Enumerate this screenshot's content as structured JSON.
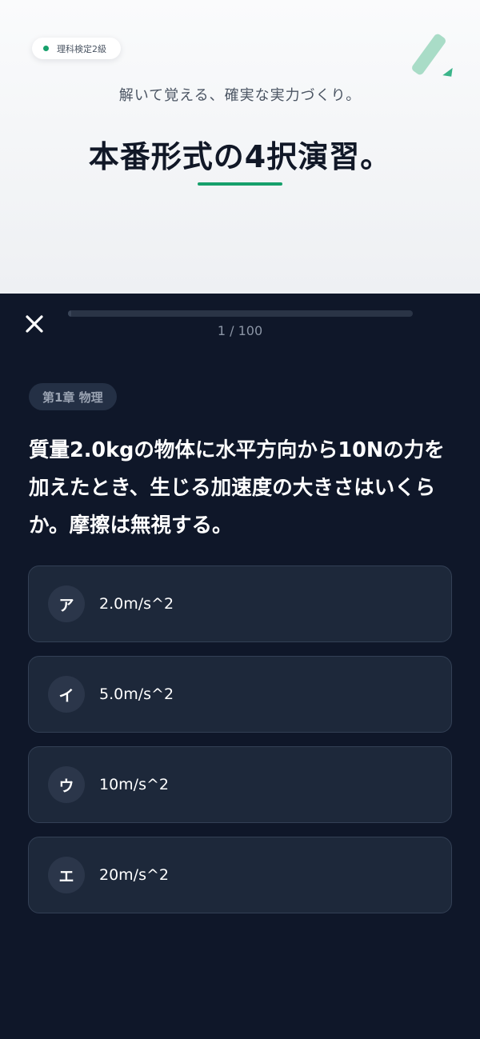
{
  "promo": {
    "badge_label": "理科検定2級",
    "subtitle": "解いて覚える、確実な実力づくり。",
    "headline": "本番形式の4択演習。"
  },
  "quiz": {
    "progress": {
      "text": "1 / 100",
      "current": 1,
      "total": 100
    },
    "chapter_tag": "第1章 物理",
    "question": "質量2.0kgの物体に水平方向から10Nの力を加えたとき、生じる加速度の大きさはいくらか。摩擦は無視する。",
    "options": [
      {
        "label": "ア",
        "text": "2.0m/s^2"
      },
      {
        "label": "イ",
        "text": "5.0m/s^2"
      },
      {
        "label": "ウ",
        "text": "10m/s^2"
      },
      {
        "label": "エ",
        "text": "20m/s^2"
      }
    ]
  },
  "icons": {
    "close": "close-icon"
  },
  "colors": {
    "accent": "#16a06b",
    "background": "#0f1729",
    "card": "#1d283a",
    "header_bg": "#f3f4f6"
  }
}
